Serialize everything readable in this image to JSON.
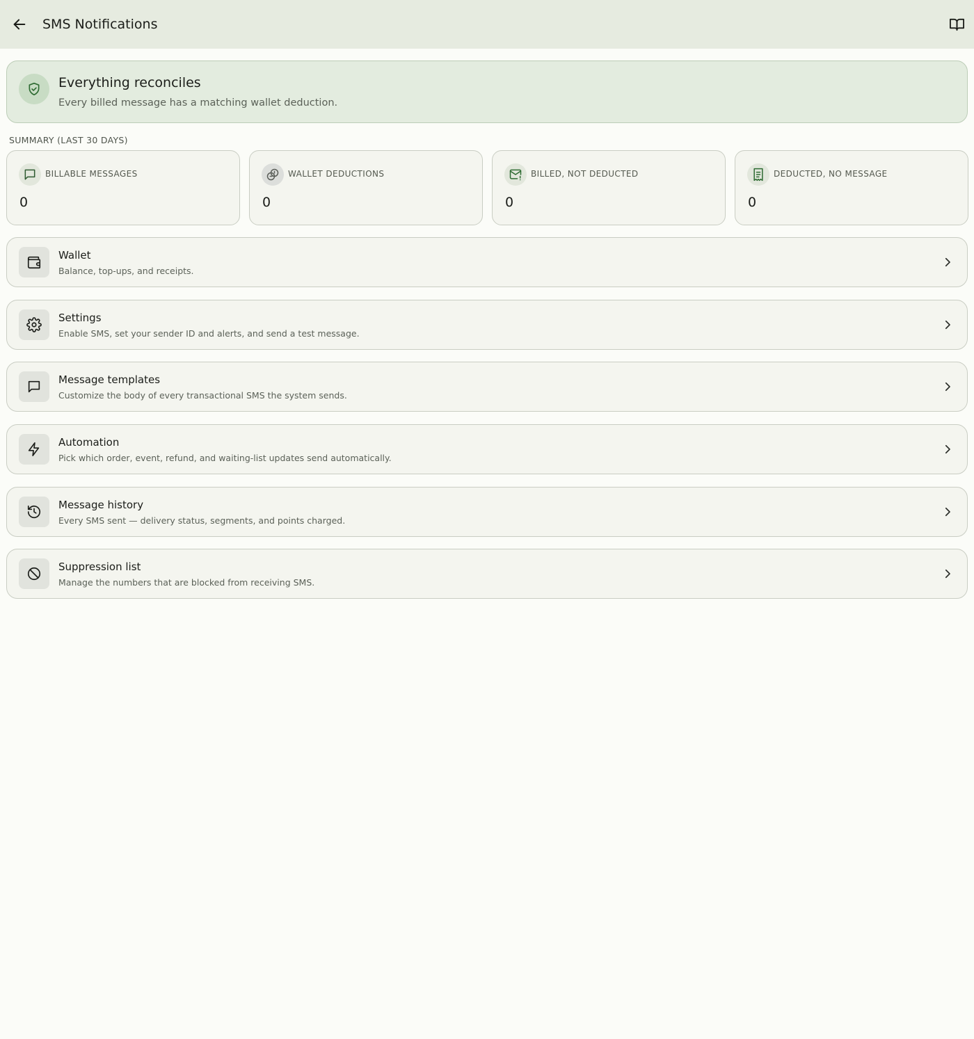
{
  "appbar": {
    "title": "SMS Notifications",
    "back_icon": "arrow-left-icon",
    "docs_icon": "book-open-icon"
  },
  "banner": {
    "icon": "shield-check-icon",
    "heading": "Everything reconciles",
    "subtext": "Every billed message has a matching wallet deduction."
  },
  "summary": {
    "label": "SUMMARY (LAST 30 DAYS)",
    "cards": [
      {
        "icon": "message-square-icon",
        "label": "BILLABLE MESSAGES",
        "value": "0"
      },
      {
        "icon": "coins-icon",
        "label": "WALLET DEDUCTIONS",
        "value": "0"
      },
      {
        "icon": "mail-warning-icon",
        "label": "BILLED, NOT DEDUCTED",
        "value": "0"
      },
      {
        "icon": "receipt-icon",
        "label": "DEDUCTED, NO MESSAGE",
        "value": "0"
      }
    ]
  },
  "nav": [
    {
      "icon": "wallet-icon",
      "title": "Wallet",
      "description": "Balance, top-ups, and receipts."
    },
    {
      "icon": "gear-icon",
      "title": "Settings",
      "description": "Enable SMS, set your sender ID and alerts, and send a test message."
    },
    {
      "icon": "message-square-icon",
      "title": "Message templates",
      "description": "Customize the body of every transactional SMS the system sends."
    },
    {
      "icon": "zap-icon",
      "title": "Automation",
      "description": "Pick which order, event, refund, and waiting-list updates send automatically."
    },
    {
      "icon": "history-icon",
      "title": "Message history",
      "description": "Every SMS sent — delivery status, segments, and points charged."
    },
    {
      "icon": "ban-icon",
      "title": "Suppression list",
      "description": "Manage the numbers that are blocked from receiving SMS."
    }
  ],
  "colors": {
    "appbar_bg": "#e6ebe0",
    "banner_bg": "#e3ecdf",
    "accent_green": "#2e6b32",
    "card_bg": "#f4f5ef"
  }
}
